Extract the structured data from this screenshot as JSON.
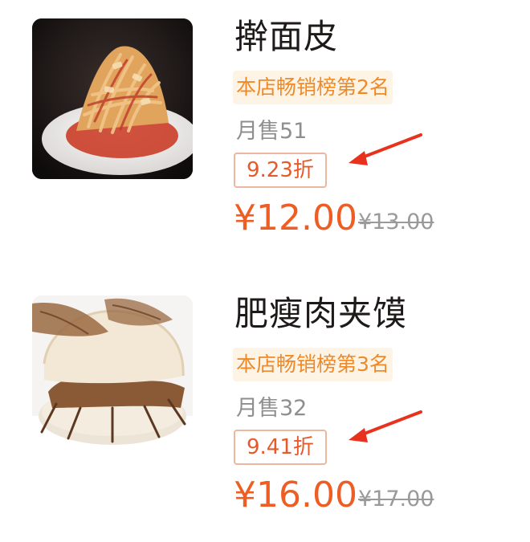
{
  "dishes": [
    {
      "name": "擀面皮",
      "rank": "本店畅销榜第2名",
      "sales": "月售51",
      "discount": "9.23折",
      "price": "¥12.00",
      "original_price": "¥13.00",
      "image_desc": "noodle-dish-photo"
    },
    {
      "name": "肥瘦肉夹馍",
      "rank": "本店畅销榜第3名",
      "sales": "月售32",
      "discount": "9.41折",
      "price": "¥16.00",
      "original_price": "¥17.00",
      "image_desc": "roujiamo-photo"
    }
  ],
  "colors": {
    "price": "#ee5d24",
    "rank_text": "#ef8a2a",
    "rank_bg": "#fdf4e6",
    "discount_border": "#ecb7a1",
    "annotation_arrow": "#e8321e"
  }
}
